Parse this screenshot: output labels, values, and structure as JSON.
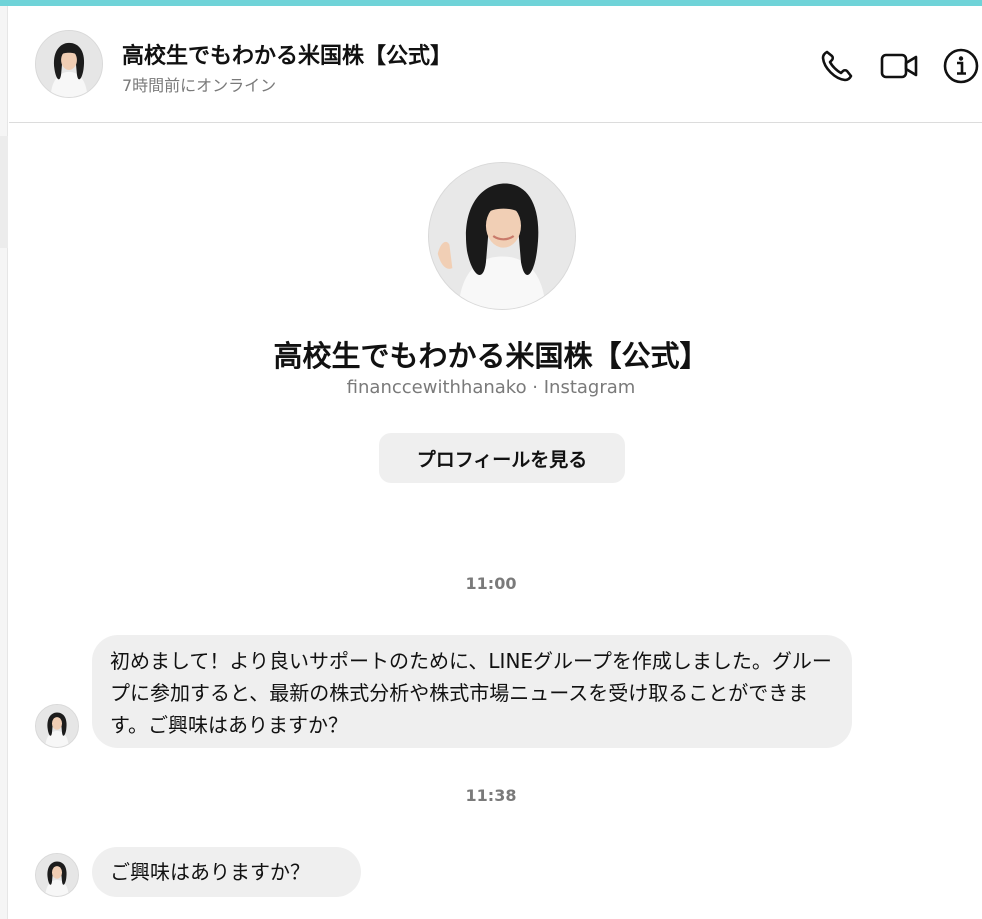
{
  "header": {
    "title": "高校生でもわかる米国株【公式】",
    "status": "7時間前にオンライン",
    "icons": [
      "phone-icon",
      "video-camera-icon",
      "info-icon"
    ]
  },
  "profile": {
    "name": "高校生でもわかる米国株【公式】",
    "subtitle": "financcewithhanako · Instagram",
    "view_profile_label": "プロフィールを見る"
  },
  "messages": [
    {
      "time": "11:00",
      "text": "初めまして！より良いサポートのために、LINEグループを作成しました。グループに参加すると、最新の株式分析や株式市場ニュースを受け取ることができます。ご興味はありますか？"
    },
    {
      "time": "11:38",
      "text": "ご興味はありますか？"
    }
  ],
  "colors": {
    "accent_bar": "#6fd3d8",
    "bubble": "#efefef",
    "button": "#efefef",
    "muted_text": "#7a7a7a"
  }
}
